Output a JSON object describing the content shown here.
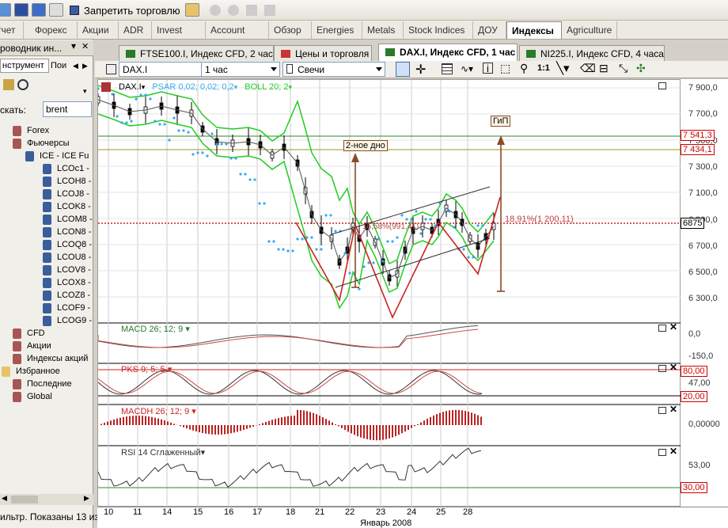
{
  "toolbar": {
    "stop_trading": "Запретить торговлю"
  },
  "navtabs": [
    "тчет",
    "Форекс",
    "Акции",
    "ADR",
    "Invest",
    "Account",
    "Обзор",
    "Energies",
    "Metals",
    "Stock Indices",
    "ДОУ",
    "Индексы",
    "Agriculture"
  ],
  "left_panel": {
    "title": "роводник ин...",
    "tab_instrument": "нструмент",
    "tab_search": "Пои",
    "search_label": "скать:",
    "search_value": "brent",
    "tree": [
      {
        "label": "Forex",
        "level": 1
      },
      {
        "label": "Фьючерсы",
        "level": 1
      },
      {
        "label": "ICE - ICE Fu",
        "level": 2
      },
      {
        "label": "LCOc1 -",
        "level": 3
      },
      {
        "label": "LCOH8 -",
        "level": 3
      },
      {
        "label": "LCOJ8 -",
        "level": 3
      },
      {
        "label": "LCOK8 -",
        "level": 3
      },
      {
        "label": "LCOM8 -",
        "level": 3
      },
      {
        "label": "LCON8 -",
        "level": 3
      },
      {
        "label": "LCOQ8 -",
        "level": 3
      },
      {
        "label": "LCOU8 -",
        "level": 3
      },
      {
        "label": "LCOV8 -",
        "level": 3
      },
      {
        "label": "LCOX8 -",
        "level": 3
      },
      {
        "label": "LCOZ8 -",
        "level": 3
      },
      {
        "label": "LCOF9 -",
        "level": 3
      },
      {
        "label": "LCOG9 -",
        "level": 3
      },
      {
        "label": "CFD",
        "level": 1
      },
      {
        "label": "Акции",
        "level": 1
      },
      {
        "label": "Индексы акций",
        "level": 1
      },
      {
        "label": "Избранное",
        "level": 0
      },
      {
        "label": "Последние",
        "level": 1
      },
      {
        "label": "Global",
        "level": 1
      }
    ],
    "status": "ильтр. Показаны 13 из"
  },
  "doc_tabs": [
    {
      "label": "FTSE100.I, Индекс CFD, 2 часа",
      "active": false
    },
    {
      "label": "Цены и торговля",
      "active": false
    },
    {
      "label": "DAX.I, Индекс CFD, 1 час",
      "active": true
    },
    {
      "label": "NI225.I, Индекс CFD, 4 часа",
      "active": false
    }
  ],
  "chart_toolbar": {
    "symbol": "DAX.I",
    "period": "1 час",
    "chart_type": "Свечи"
  },
  "legend": {
    "symbol": "DAX.I",
    "psar": "PSAR 0,02; 0,02; 0,2",
    "boll": "BOLL 20; 2"
  },
  "annotations": {
    "second_bottom": "2-ное дно",
    "hip": "ГиП",
    "pct1": "18,91%(1 200,11)",
    "pct2": "15,58%(991,41)"
  },
  "price_axis": [
    "7 900,0",
    "7 700,0",
    "7 500,0",
    "7 300,0",
    "7 100,0",
    "6 900,0",
    "6 700,0",
    "6 500,0",
    "6 300,0"
  ],
  "price_tags": {
    "p1": "7 541,3",
    "p2": "7 434,1",
    "p3": "6875"
  },
  "indicators": {
    "macd": {
      "label": "MACD 26; 12; 9",
      "ticks": [
        "0,0",
        "-150,0"
      ]
    },
    "pks": {
      "label": "PKS 9; 5; 5",
      "ticks": [
        "80,00",
        "47,00",
        "20,00"
      ]
    },
    "macdh": {
      "label": "MACDH 26; 12; 9",
      "ticks": [
        "0,00000"
      ]
    },
    "rsi": {
      "label": "RSI 14 Сглаженный",
      "ticks": [
        "53,00",
        "30,00"
      ]
    }
  },
  "date_axis": {
    "days": [
      "10",
      "11",
      "14",
      "15",
      "16",
      "17",
      "18",
      "21",
      "22",
      "23",
      "24",
      "25",
      "28"
    ],
    "month": "Январь 2008"
  },
  "colors": {
    "up": "#ffffff",
    "down": "#000000",
    "boll": "#22cc22",
    "psar": "#33aaee",
    "red": "#cc2222",
    "brown": "#8a4a2a"
  }
}
